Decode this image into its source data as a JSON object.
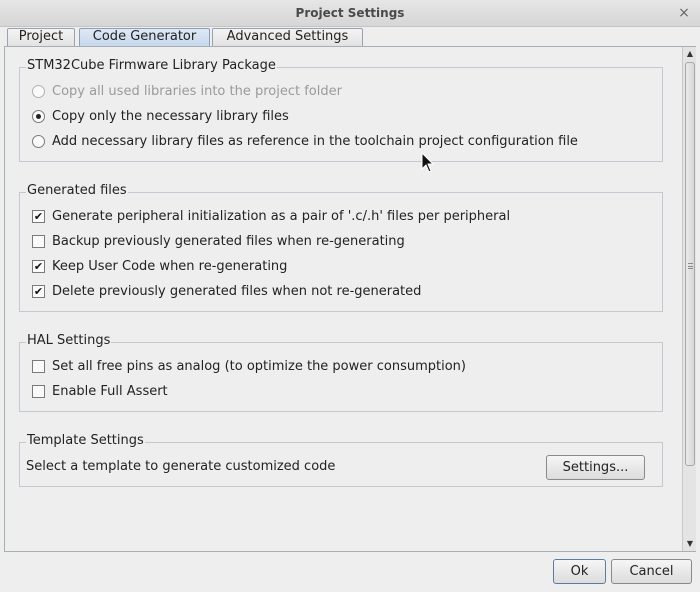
{
  "window": {
    "title": "Project Settings",
    "close_glyph": "×"
  },
  "tabs": [
    {
      "label": "Project",
      "active": false
    },
    {
      "label": "Code Generator",
      "active": true
    },
    {
      "label": "Advanced Settings",
      "active": false
    }
  ],
  "firmware": {
    "legend": "STM32Cube Firmware Library Package",
    "options": [
      {
        "label": "Copy all used libraries into the project folder",
        "selected": false,
        "enabled": false
      },
      {
        "label": "Copy only the necessary library files",
        "selected": true,
        "enabled": true
      },
      {
        "label": "Add necessary library files as reference in the toolchain project configuration file",
        "selected": false,
        "enabled": true
      }
    ]
  },
  "generated": {
    "legend": "Generated files",
    "items": [
      {
        "label": "Generate peripheral initialization as a pair of '.c/.h' files per peripheral",
        "checked": true
      },
      {
        "label": "Backup previously generated files when re-generating",
        "checked": false
      },
      {
        "label": "Keep User Code when re-generating",
        "checked": true
      },
      {
        "label": "Delete previously generated files when not re-generated",
        "checked": true
      }
    ]
  },
  "hal": {
    "legend": "HAL Settings",
    "items": [
      {
        "label": "Set all free pins as analog (to optimize the power consumption)",
        "checked": false
      },
      {
        "label": "Enable Full Assert",
        "checked": false
      }
    ]
  },
  "template": {
    "legend": "Template Settings",
    "text": "Select a template to generate customized code",
    "button": "Settings..."
  },
  "footer": {
    "ok": "Ok",
    "cancel": "Cancel"
  },
  "icons": {
    "check": "✔",
    "scroll_up": "▲",
    "scroll_down": "▼"
  }
}
